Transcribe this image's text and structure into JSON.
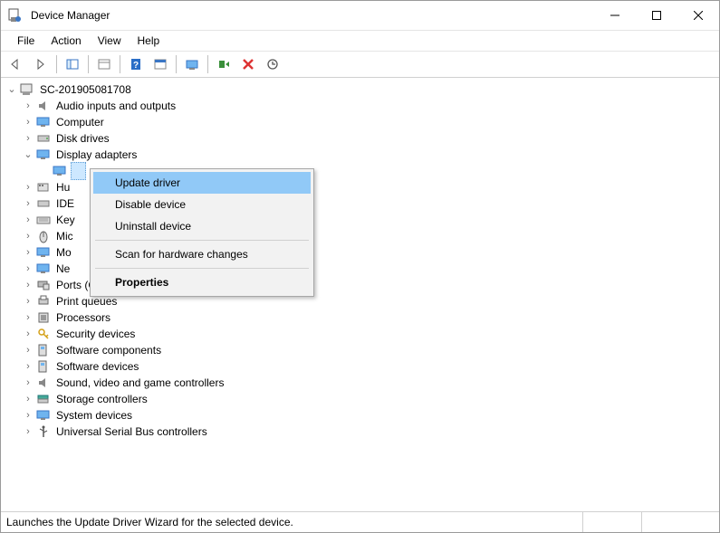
{
  "window": {
    "title": "Device Manager"
  },
  "menu": {
    "file": "File",
    "action": "Action",
    "view": "View",
    "help": "Help"
  },
  "tree": {
    "root": "SC-201905081708",
    "nodes": {
      "audio": "Audio inputs and outputs",
      "computer": "Computer",
      "disk": "Disk drives",
      "display": "Display adapters",
      "hid": "Hu",
      "ide": "IDE",
      "keyboard": "Key",
      "mice": "Mic",
      "monitor": "Mo",
      "network": "Ne",
      "ports": "Ports (COM & LPT)",
      "printq": "Print queues",
      "processors": "Processors",
      "security": "Security devices",
      "softcomp": "Software components",
      "softdev": "Software devices",
      "sound": "Sound, video and game controllers",
      "storage": "Storage controllers",
      "sysdev": "System devices",
      "usb": "Universal Serial Bus controllers"
    }
  },
  "context_menu": {
    "update": "Update driver",
    "disable": "Disable device",
    "uninstall": "Uninstall device",
    "scan": "Scan for hardware changes",
    "properties": "Properties"
  },
  "statusbar": {
    "text": "Launches the Update Driver Wizard for the selected device."
  }
}
